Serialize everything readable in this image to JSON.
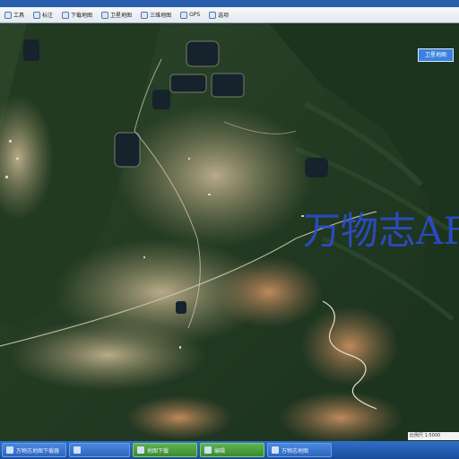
{
  "toolbar": {
    "items": [
      {
        "label": "工具",
        "icon": "tool-icon"
      },
      {
        "label": "标注",
        "icon": "pin-icon"
      },
      {
        "label": "下载地图",
        "icon": "download-icon"
      },
      {
        "label": "卫星地图",
        "icon": "satellite-icon"
      },
      {
        "label": "三维地图",
        "icon": "globe-icon"
      },
      {
        "label": "GPS",
        "icon": "gps-icon"
      },
      {
        "label": "选项",
        "icon": "settings-icon"
      }
    ]
  },
  "map": {
    "type_button": "卫星地图",
    "watermark": "万物志AF",
    "scale_text": "比例尺 1:5000"
  },
  "taskbar": {
    "items": [
      {
        "label": "万物志地图下载器",
        "style": "blue"
      },
      {
        "label": "",
        "style": "blue"
      },
      {
        "label": "地图下载",
        "style": "green"
      },
      {
        "label": "编辑",
        "style": "green"
      },
      {
        "label": "万物志地图",
        "style": "blue"
      }
    ]
  },
  "colors": {
    "forest_dark": "#1f3a22",
    "forest_mid": "#2f4d2a",
    "clearing": "#a89b78",
    "soil": "#b07a52",
    "water": "#1a2630",
    "road": "#d9d0bd",
    "watermark": "#2c4fd8"
  }
}
